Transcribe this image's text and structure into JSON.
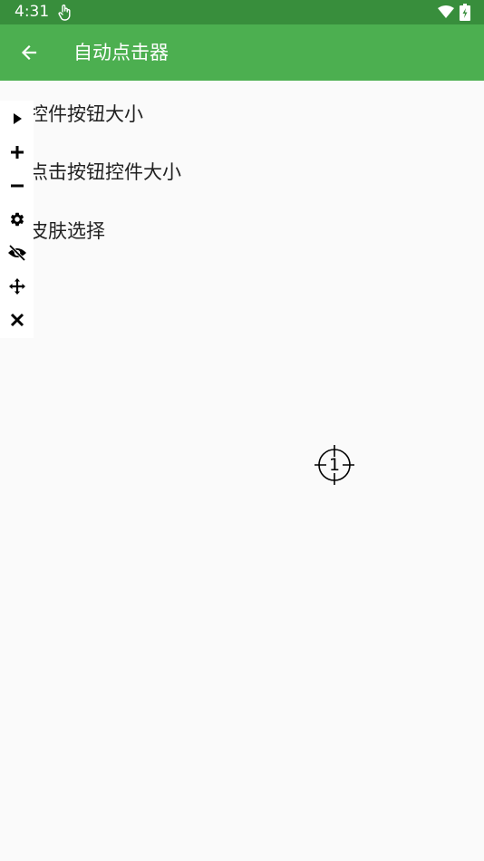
{
  "status_bar": {
    "time": "4:31",
    "background": "#388e3c",
    "icons": [
      "touch-icon",
      "wifi-icon",
      "battery-charging-icon"
    ]
  },
  "app_bar": {
    "title": "自动点击器",
    "background": "#4caf50",
    "back_icon": "arrow-left-icon"
  },
  "settings": {
    "items": [
      {
        "label": "控件按钮大小"
      },
      {
        "label": "点击按钮控件大小"
      },
      {
        "label": "皮肤选择"
      }
    ]
  },
  "floating_toolbar": {
    "buttons": [
      {
        "name": "play-icon"
      },
      {
        "name": "plus-icon"
      },
      {
        "name": "minus-icon"
      },
      {
        "name": "gear-icon"
      },
      {
        "name": "eye-off-icon"
      },
      {
        "name": "move-icon"
      },
      {
        "name": "close-icon"
      }
    ]
  },
  "click_target": {
    "number": "1",
    "icon": "crosshair-icon"
  }
}
